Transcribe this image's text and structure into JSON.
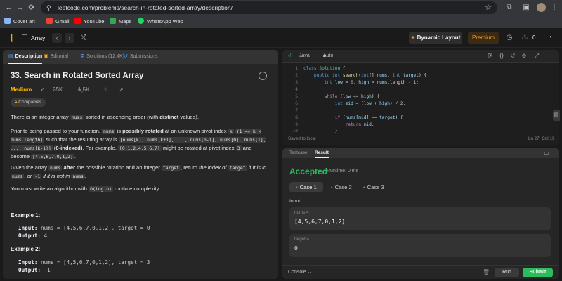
{
  "browser": {
    "url": "leetcode.com/problems/search-in-rotated-sorted-array/description/",
    "bookmarks": [
      {
        "label": "Cover art",
        "color": "#8ab4f8"
      },
      {
        "label": "Gmail",
        "color": "#ea4335"
      },
      {
        "label": "YouTube",
        "color": "#ff0000"
      },
      {
        "label": "Maps",
        "color": "#34a853"
      },
      {
        "label": "WhatsApp Web",
        "color": "#25d366"
      }
    ]
  },
  "header": {
    "problem_list": "Array",
    "dynamic_layout": "Dynamic Layout",
    "premium": "Premium",
    "coin_count": "0"
  },
  "description": {
    "tabs": [
      "Description",
      "Editorial",
      "Solutions (12.4K)",
      "Submissions"
    ],
    "title": "33. Search in Rotated Sorted Array",
    "difficulty": "Medium",
    "likes": "25K",
    "dislikes": "1.5K",
    "companies": "Companies",
    "p1": {
      "a": "There is an integer array ",
      "code": "nums",
      "b": " sorted in ascending order (with ",
      "bold": "distinct",
      "c": " values)."
    },
    "p2": {
      "t1": "Prior to being passed to your function, ",
      "c1": "nums",
      "t2": " is ",
      "b1": "possibly rotated",
      "t3": " at an unknown pivot index ",
      "c2": "k",
      "t4": " ",
      "c3": "(1 <= k < nums.length)",
      "t5": " such that the resulting array is ",
      "c4": "[nums[k], nums[k+1], ..., nums[n-1], nums[0], nums[1], ..., nums[k-1]]",
      "t6": " ",
      "b2": "(0-indexed)",
      "t7": ". For example, ",
      "c5": "[0,1,2,4,5,6,7]",
      "t8": " might be rotated at pivot index ",
      "c6": "3",
      "t9": " and become ",
      "c7": "[4,5,6,7,0,1,2]",
      "t10": "."
    },
    "p3": {
      "t1": "Given the array ",
      "c1": "nums",
      "t2": " ",
      "b1": "after",
      "t3": " the possible rotation and an integer ",
      "c2": "target",
      "t4": ", return ",
      "i1": "the index of ",
      "c3": "target",
      "i2": " if it is in ",
      "c4": "nums",
      "i3": ", or ",
      "c5": "-1",
      "i4": " if it is not in ",
      "c6": "nums",
      "t5": "."
    },
    "p4": {
      "t1": "You must write an algorithm with ",
      "c1": "O(log n)",
      "t2": " runtime complexity."
    },
    "examples": [
      {
        "title": "Example 1:",
        "input_label": "Input:",
        "input": " nums = [4,5,6,7,0,1,2], target = 0",
        "output_label": "Output:",
        "output": " 4"
      },
      {
        "title": "Example 2:",
        "input_label": "Input:",
        "input": " nums = [4,5,6,7,0,1,2], target = 3",
        "output_label": "Output:",
        "output": " -1"
      }
    ]
  },
  "editor": {
    "language": "Java",
    "mode": "Auto",
    "saved": "Saved to local",
    "cursor": "Ln 27, Col 19",
    "line_numbers": [
      "1",
      "2",
      "3",
      "4",
      "5",
      "6",
      "7",
      "8",
      "9",
      "10"
    ]
  },
  "result": {
    "tabs": [
      "Testcase",
      "Result"
    ],
    "status": "Accepted",
    "runtime": "Runtime: 0 ms",
    "cases": [
      "Case 1",
      "Case 2",
      "Case 3"
    ],
    "input_label": "Input",
    "fields": [
      {
        "name": "nums =",
        "value": "[4,5,6,7,0,1,2]"
      },
      {
        "name": "target =",
        "value": "0"
      }
    ],
    "console": "Console",
    "run": "Run",
    "submit": "Submit"
  }
}
